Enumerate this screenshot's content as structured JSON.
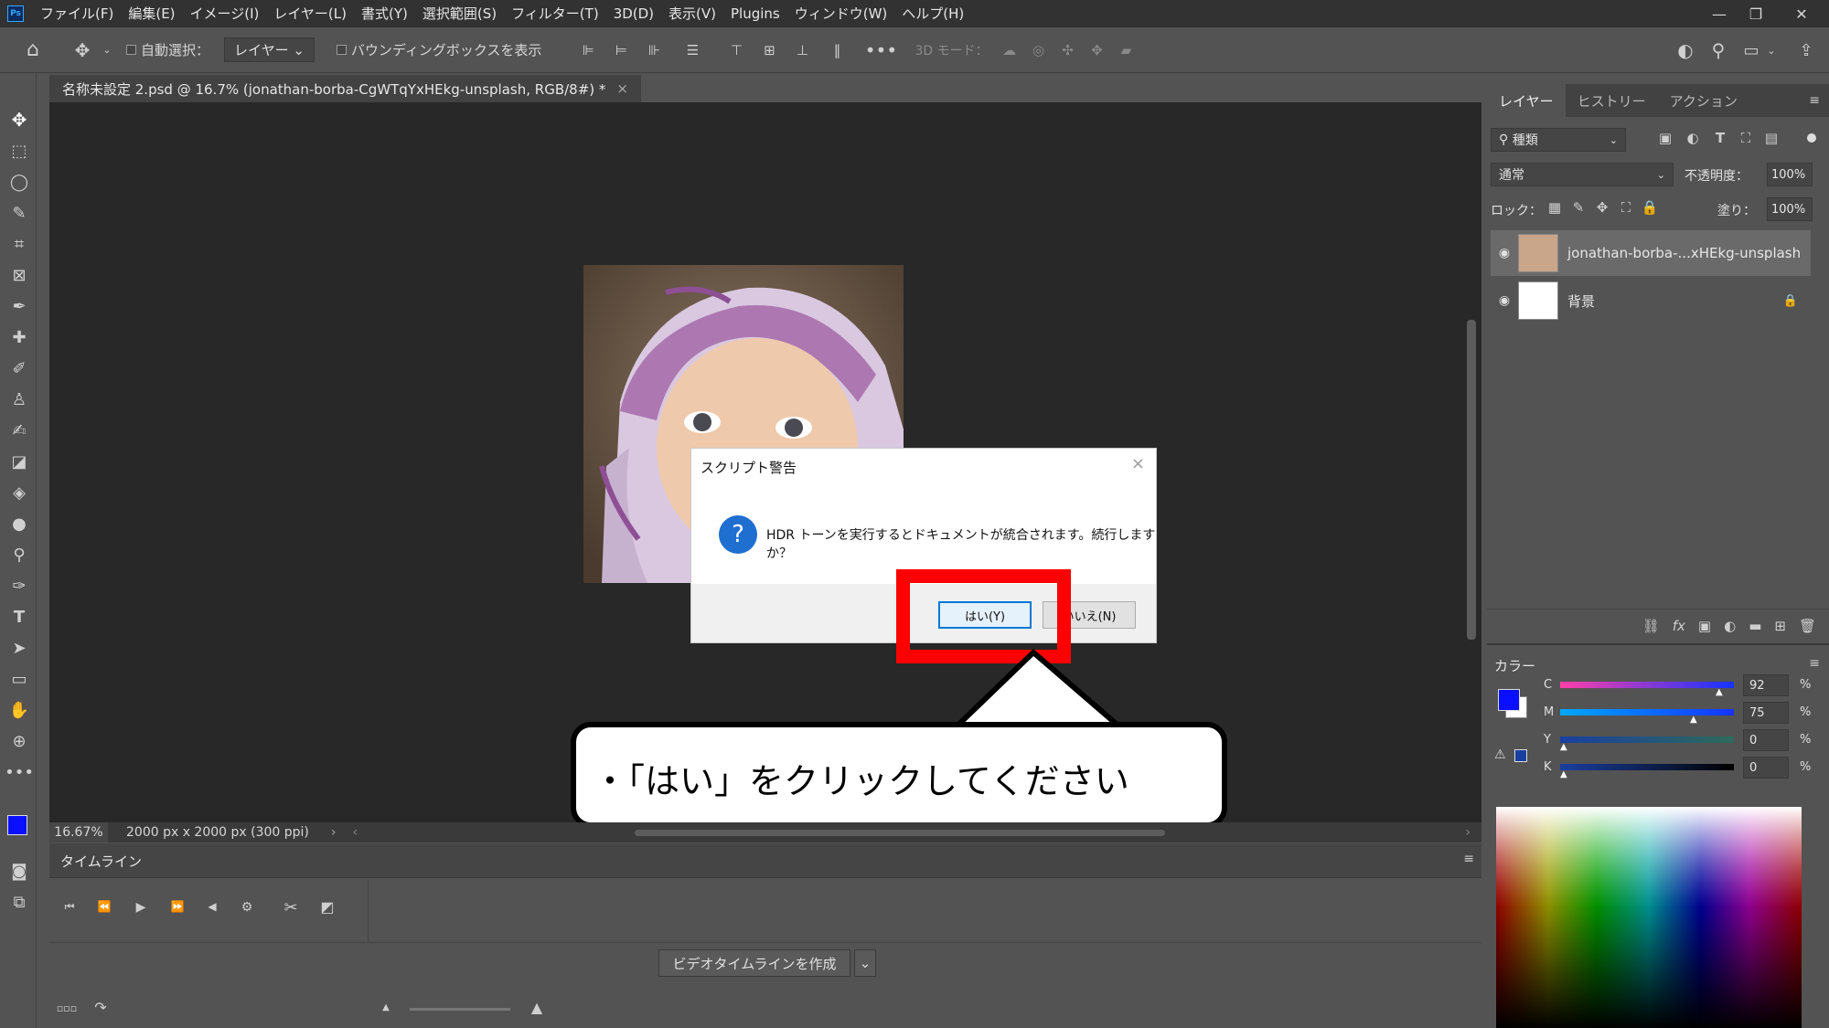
{
  "menubar": {
    "logo": "Ps",
    "items": [
      "ファイル(F)",
      "編集(E)",
      "イメージ(I)",
      "レイヤー(L)",
      "書式(Y)",
      "選択範囲(S)",
      "フィルター(T)",
      "3D(D)",
      "表示(V)",
      "Plugins",
      "ウィンドウ(W)",
      "ヘルプ(H)"
    ]
  },
  "options": {
    "auto_select_label": "自動選択：",
    "auto_select_value": "レイヤー",
    "bbox_label": "バウンディングボックスを表示",
    "mode3d_label": "3D モード："
  },
  "document": {
    "tab_title": "名称未設定 2.psd @ 16.7% (jonathan-borba-CgWTqYxHEkg-unsplash, RGB/8#) *",
    "zoom": "16.67%",
    "size_info": "2000 px x 2000 px (300 ppi)"
  },
  "dialog": {
    "title": "スクリプト警告",
    "message": "HDR トーンを実行するとドキュメントが統合されます。続行しますか？",
    "yes_label": "はい(Y)",
    "no_label": "いいえ(N)"
  },
  "callout": {
    "text": "・「はい」をクリックしてください"
  },
  "timeline": {
    "tab": "タイムライン",
    "create_button": "ビデオタイムラインを作成"
  },
  "layers_panel": {
    "tabs": [
      "レイヤー",
      "ヒストリー",
      "アクション"
    ],
    "filter_label": "種類",
    "blend_mode": "通常",
    "opacity_label": "不透明度：",
    "opacity_value": "100%",
    "lock_label": "ロック：",
    "fill_label": "塗り：",
    "fill_value": "100%",
    "layers": [
      {
        "name": "jonathan-borba-...xHEkg-unsplash",
        "selected": true
      },
      {
        "name": "背景",
        "locked": true
      }
    ]
  },
  "color_panel": {
    "title": "カラー",
    "foreground": "#0a10ff",
    "channels": [
      {
        "label": "C",
        "value": "92",
        "unit": "%"
      },
      {
        "label": "M",
        "value": "75",
        "unit": "%"
      },
      {
        "label": "Y",
        "value": "0",
        "unit": "%"
      },
      {
        "label": "K",
        "value": "0",
        "unit": "%"
      }
    ]
  },
  "colors": {
    "highlight_red": "#ff0000",
    "accent_blue": "#0078d7"
  }
}
